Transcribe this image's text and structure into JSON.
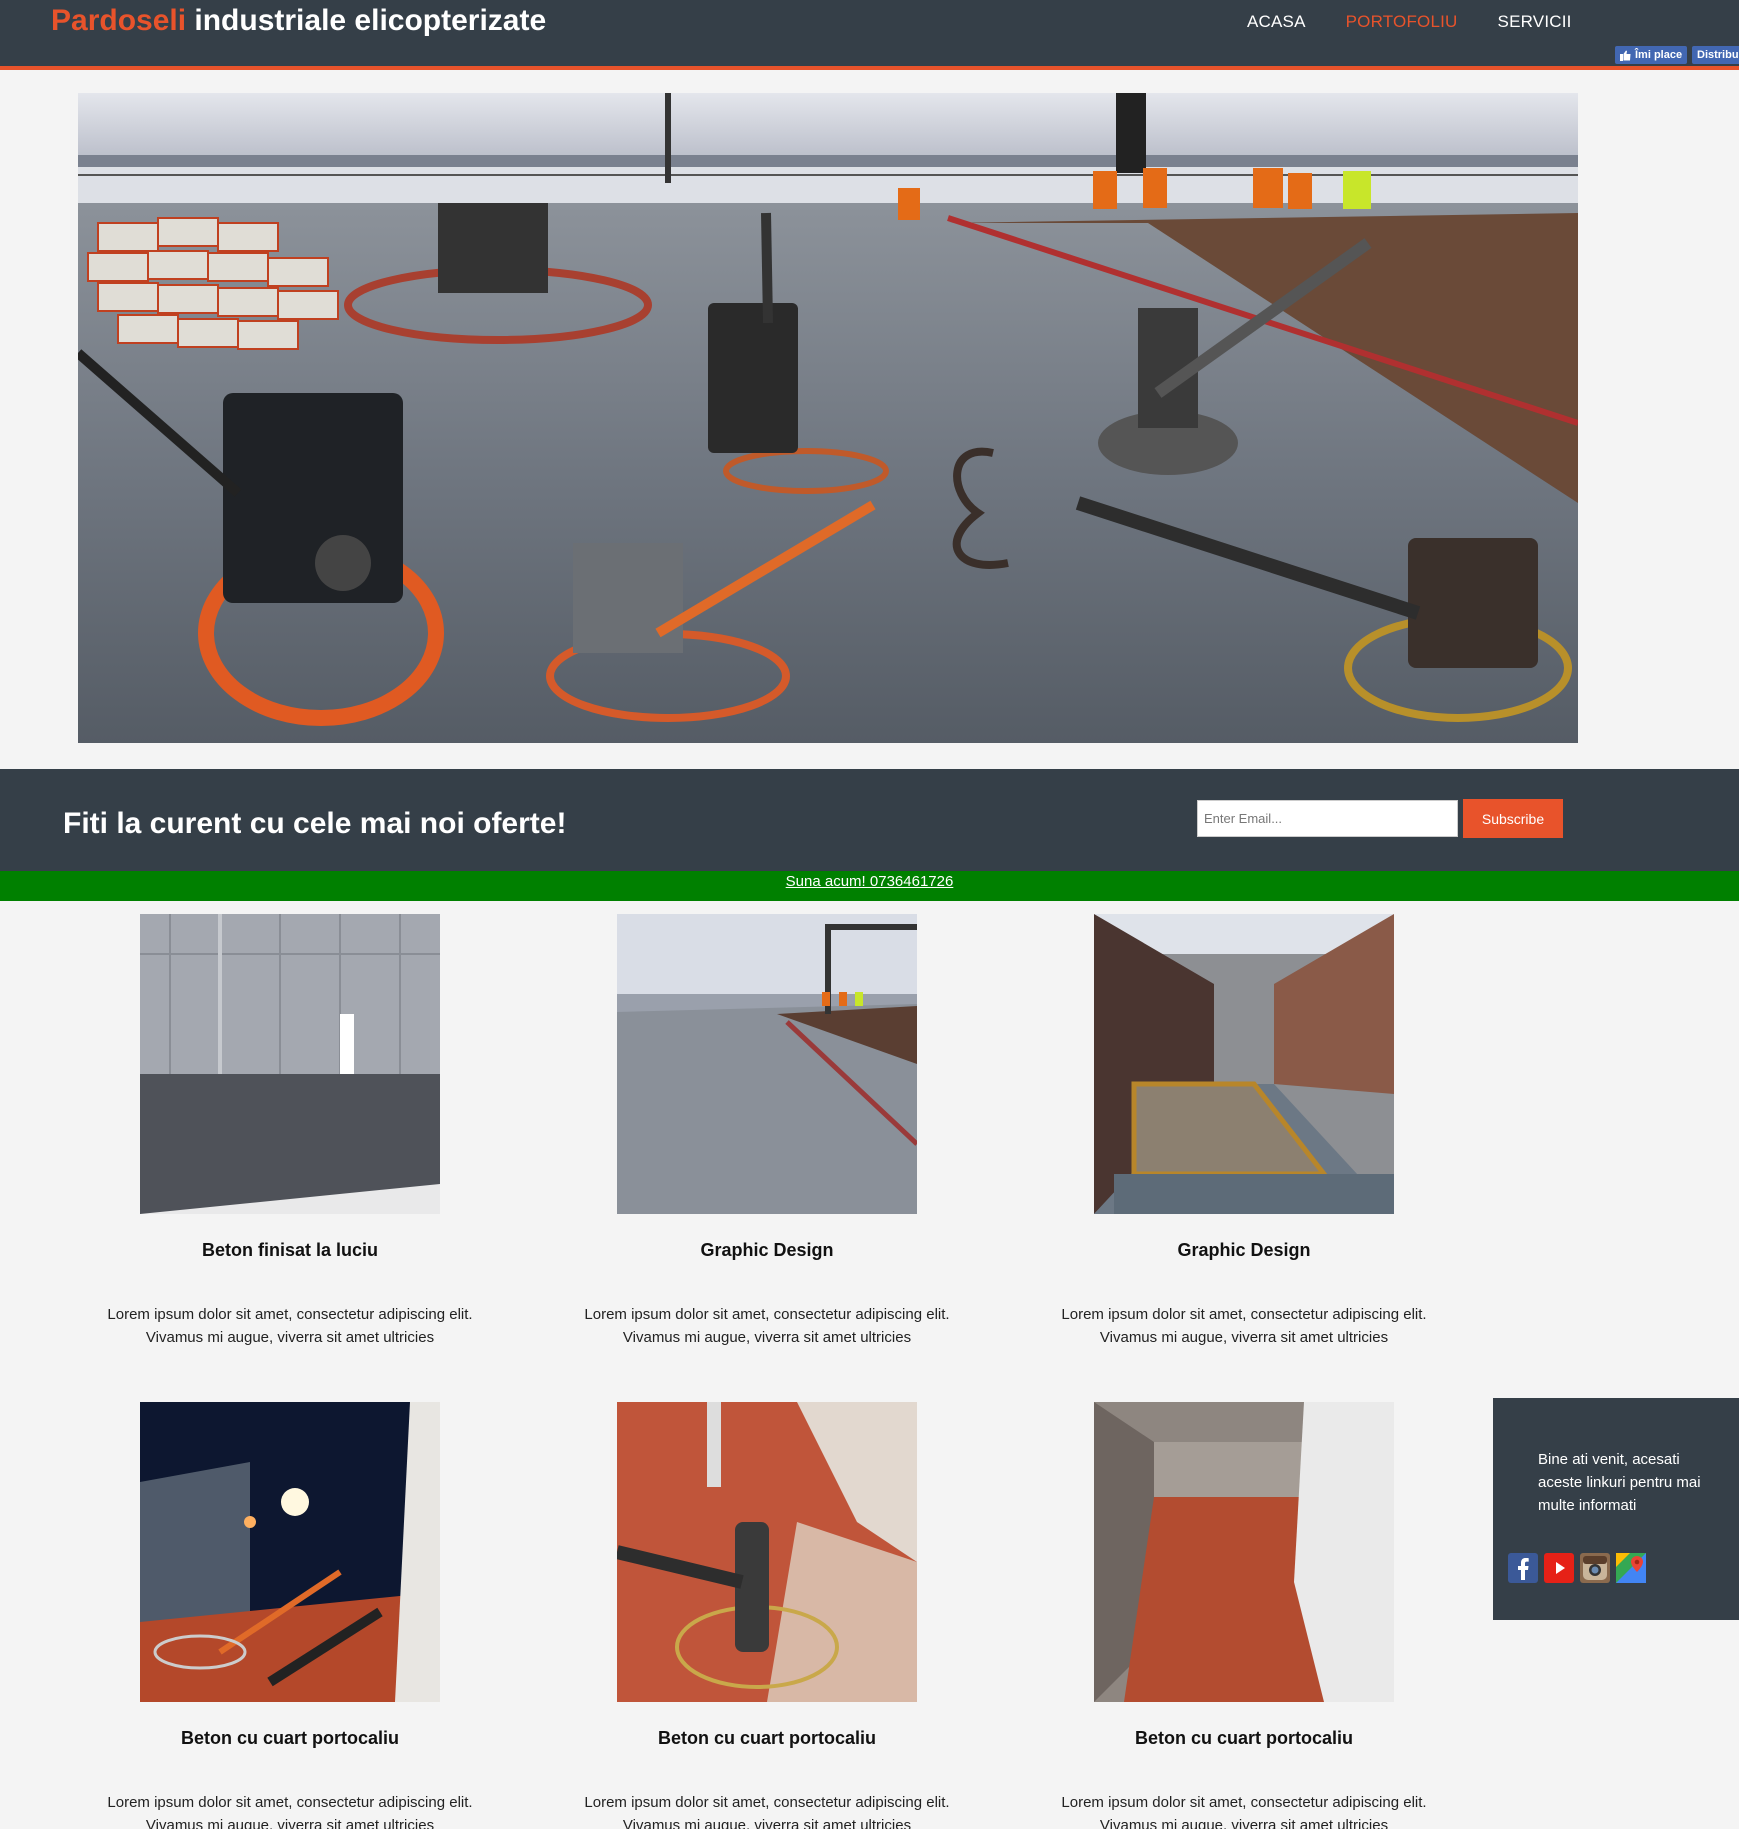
{
  "header": {
    "logo_brand": "Pardoseli",
    "logo_rest": " industriale elicopterizate",
    "nav": [
      {
        "label": "ACASA"
      },
      {
        "label": "PORTOFOLIU"
      },
      {
        "label": "SERVICII"
      }
    ],
    "fb_like": "Îmi place",
    "fb_share": "Distribuie"
  },
  "newsletter": {
    "heading": "Fiti la curent cu cele mai noi oferte!",
    "email_placeholder": "Enter Email...",
    "subscribe_label": "Subscribe"
  },
  "callbar": {
    "link_text": "Suna acum! 0736461726"
  },
  "portfolio": [
    {
      "title": "Beton finisat la luciu",
      "text": "Lorem ipsum dolor sit amet, consectetur adipiscing elit. Vivamus mi augue, viverra sit amet ultricies"
    },
    {
      "title": "Graphic Design",
      "text": "Lorem ipsum dolor sit amet, consectetur adipiscing elit. Vivamus mi augue, viverra sit amet ultricies"
    },
    {
      "title": "Graphic Design",
      "text": "Lorem ipsum dolor sit amet, consectetur adipiscing elit. Vivamus mi augue, viverra sit amet ultricies"
    },
    {
      "title": "Beton cu cuart portocaliu",
      "text": "Lorem ipsum dolor sit amet, consectetur adipiscing elit. Vivamus mi augue, viverra sit amet ultricies"
    },
    {
      "title": "Beton cu cuart portocaliu",
      "text": "Lorem ipsum dolor sit amet, consectetur adipiscing elit. Vivamus mi augue, viverra sit amet ultricies"
    },
    {
      "title": "Beton cu cuart portocaliu",
      "text": "Lorem ipsum dolor sit amet, consectetur adipiscing elit. Vivamus mi augue, viverra sit amet ultricies"
    }
  ],
  "side_widget": {
    "text": "Bine ati venit, acesati aceste linkuri pentru mai multe informati",
    "icons": [
      "facebook-icon",
      "youtube-icon",
      "instagram-icon",
      "google-maps-icon"
    ]
  },
  "colors": {
    "header_bg": "#353f48",
    "accent": "#e8532b",
    "callbar_bg": "#008000",
    "page_bg": "#f4f4f4"
  }
}
